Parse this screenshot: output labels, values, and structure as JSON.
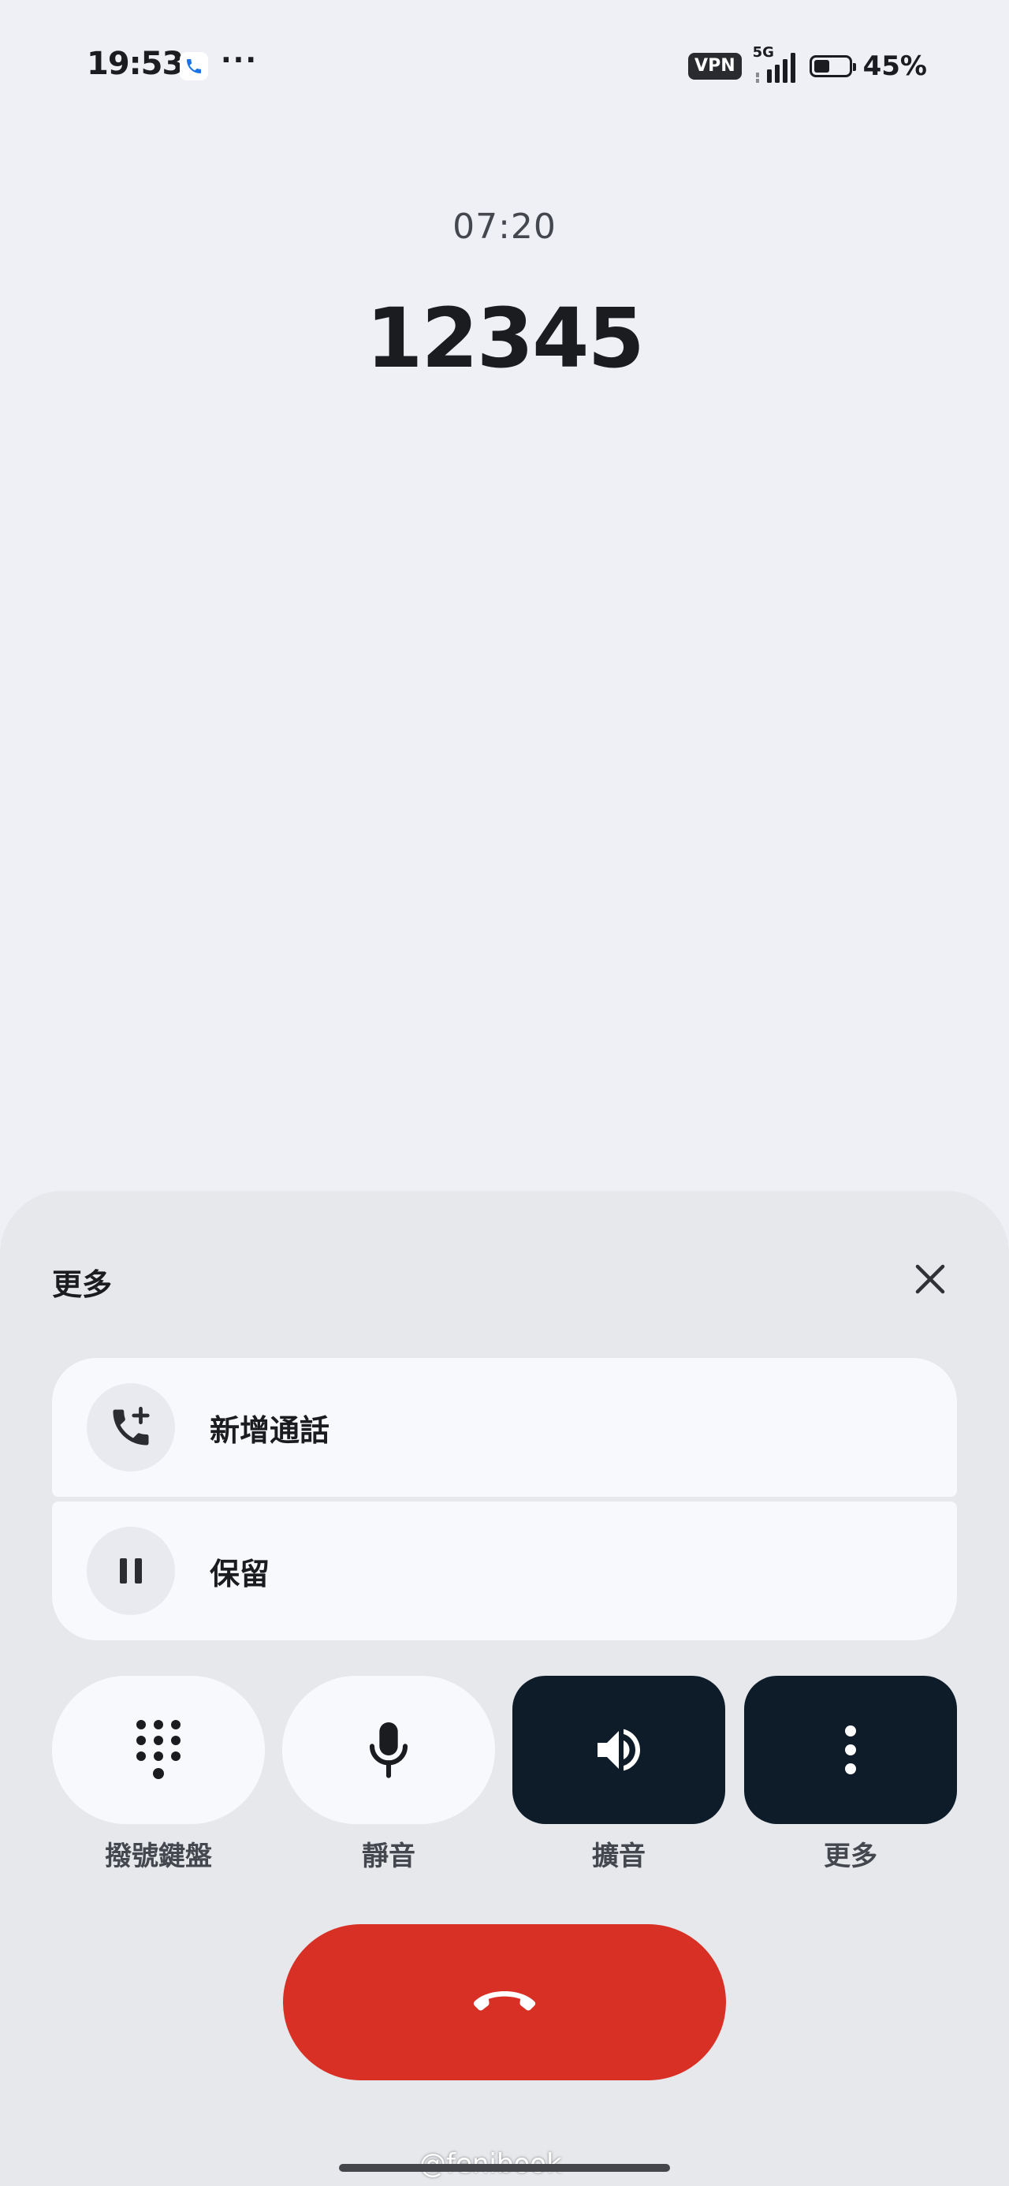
{
  "status_bar": {
    "time": "19:53",
    "more_indicator": "···",
    "vpn_label": "VPN",
    "network_label": "5G",
    "battery_percent_text": "45%",
    "battery_level": 0.45
  },
  "call": {
    "timer": "07:20",
    "number": "12345"
  },
  "sheet": {
    "title": "更多",
    "menu_items": [
      {
        "label": "新增通話",
        "icon": "add-call-icon"
      },
      {
        "label": "保留",
        "icon": "pause-icon"
      }
    ],
    "controls": [
      {
        "label": "撥號鍵盤",
        "icon": "dialpad-icon",
        "active": false
      },
      {
        "label": "靜音",
        "icon": "microphone-icon",
        "active": false
      },
      {
        "label": "擴音",
        "icon": "speaker-icon",
        "active": true
      },
      {
        "label": "更多",
        "icon": "more-vertical-icon",
        "active": true
      }
    ],
    "end_call_icon": "end-call-icon"
  },
  "watermark": "@fenibook",
  "colors": {
    "background": "#eef0f5",
    "sheet": "#e7e8ec",
    "card": "#f7f9fd",
    "active_button": "#0e1c2a",
    "end_call": "#d93025",
    "text_primary": "#1b1c20",
    "text_secondary": "#45474e"
  }
}
